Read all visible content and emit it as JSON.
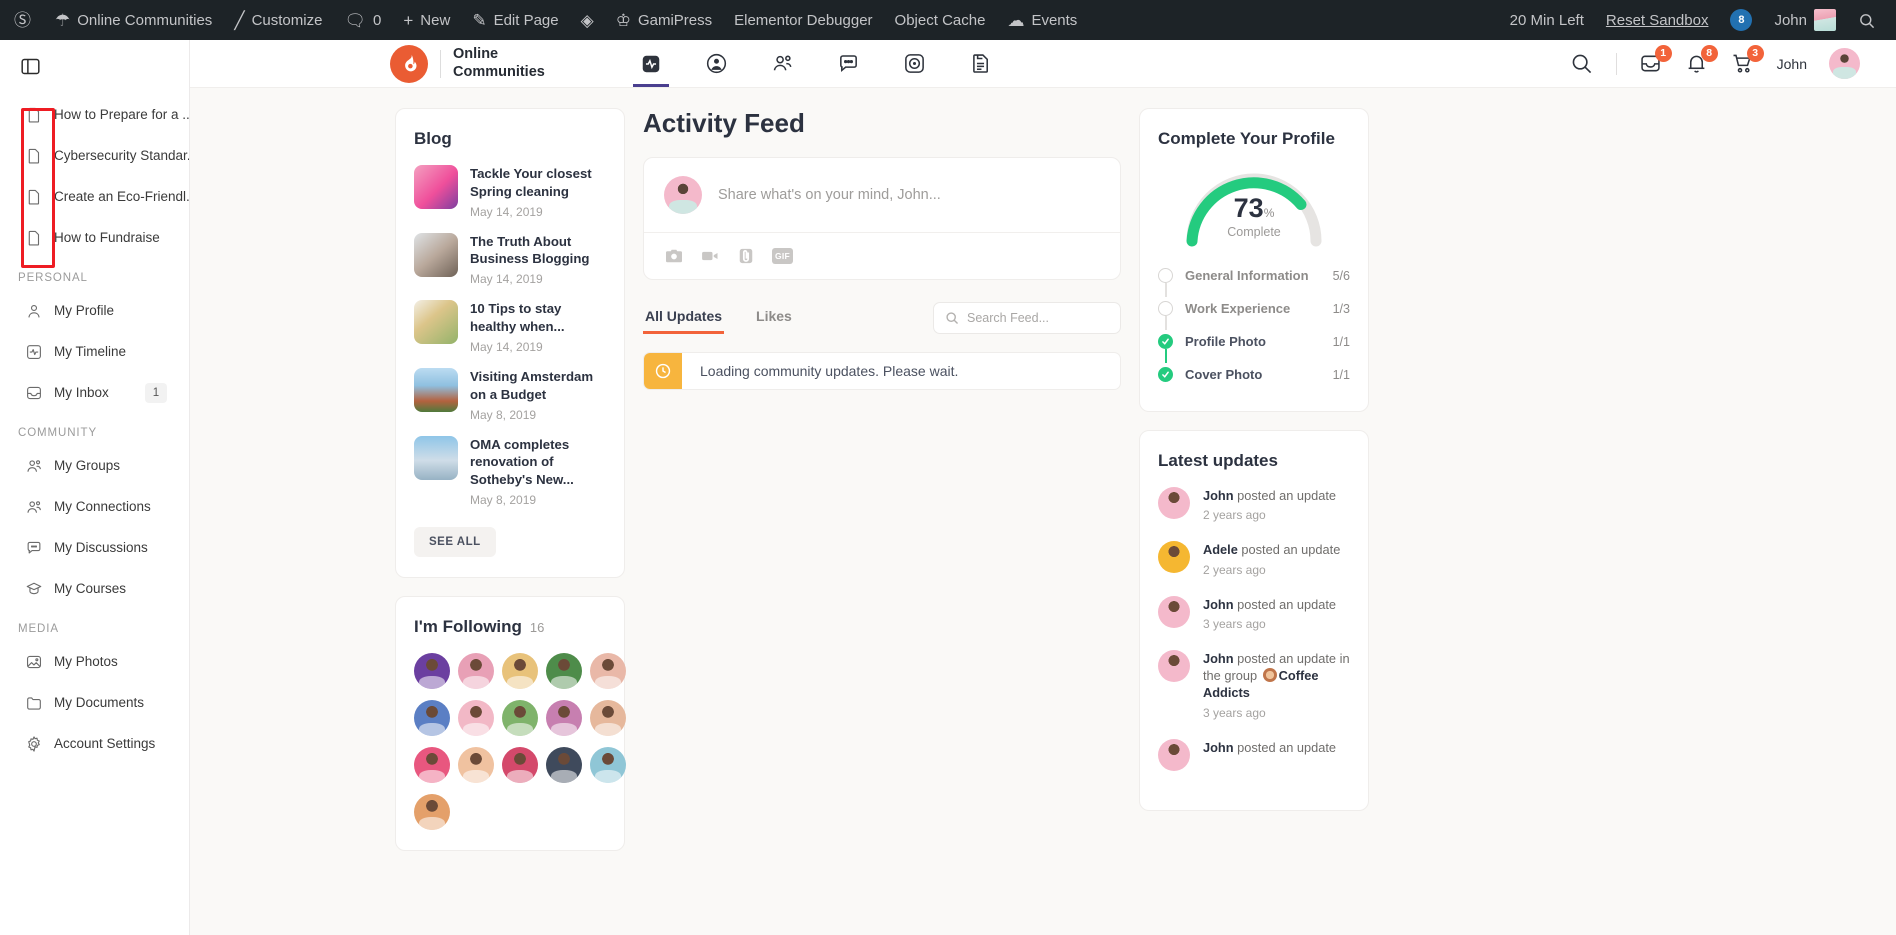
{
  "wp_admin_bar": {
    "left_items": [
      {
        "label": "",
        "icon": "wordpress-logo-icon"
      },
      {
        "label": "Online Communities",
        "icon": "dashboard-icon"
      },
      {
        "label": "Customize",
        "icon": "pencil-icon"
      },
      {
        "label": "0",
        "icon": "comment-icon"
      },
      {
        "label": "New",
        "icon": "plus-icon"
      },
      {
        "label": "Edit Page",
        "icon": "edit-icon"
      },
      {
        "label": "",
        "icon": "diamond-icon"
      },
      {
        "label": "GamiPress",
        "icon": "crown-icon"
      },
      {
        "label": "Elementor Debugger",
        "icon": ""
      },
      {
        "label": "Object Cache",
        "icon": ""
      },
      {
        "label": "Events",
        "icon": "events-icon"
      }
    ],
    "time_left": "20 Min Left",
    "reset_label": "Reset Sandbox",
    "notif_count": "8",
    "user_name": "John"
  },
  "sidebar": {
    "toggle_icon": "panel-toggle-icon",
    "pinned_items": [
      {
        "label": "How to Prepare for a ...",
        "icon": "document-icon"
      },
      {
        "label": "Cybersecurity Standar...",
        "icon": "document-icon"
      },
      {
        "label": "Create an Eco-Friendl...",
        "icon": "document-icon"
      },
      {
        "label": "How to Fundraise",
        "icon": "document-icon"
      }
    ],
    "sections": [
      {
        "heading": "PERSONAL",
        "items": [
          {
            "label": "My Profile",
            "icon": "user-icon",
            "badge": ""
          },
          {
            "label": "My Timeline",
            "icon": "activity-icon",
            "badge": ""
          },
          {
            "label": "My Inbox",
            "icon": "inbox-icon",
            "badge": "1"
          }
        ]
      },
      {
        "heading": "COMMUNITY",
        "items": [
          {
            "label": "My Groups",
            "icon": "group-icon",
            "badge": ""
          },
          {
            "label": "My Connections",
            "icon": "group-icon",
            "badge": ""
          },
          {
            "label": "My Discussions",
            "icon": "chat-icon",
            "badge": ""
          },
          {
            "label": "My Courses",
            "icon": "graduation-cap-icon",
            "badge": ""
          }
        ]
      },
      {
        "heading": "MEDIA",
        "items": [
          {
            "label": "My Photos",
            "icon": "photo-icon",
            "badge": ""
          },
          {
            "label": "My Documents",
            "icon": "folder-icon",
            "badge": ""
          },
          {
            "label": "Account Settings",
            "icon": "gear-icon",
            "badge": ""
          }
        ]
      }
    ]
  },
  "header": {
    "brand_line1": "Online",
    "brand_line2": "Communities",
    "logo_icon": "flame-logo-icon",
    "nav": [
      {
        "icon": "activity-icon",
        "active": true
      },
      {
        "icon": "profile-circle-icon",
        "active": false
      },
      {
        "icon": "members-icon",
        "active": false
      },
      {
        "icon": "chat-bubble-icon",
        "active": false
      },
      {
        "icon": "target-icon",
        "active": false
      },
      {
        "icon": "document-icon",
        "active": false
      }
    ],
    "search_icon": "search-icon",
    "inbox_badge": "1",
    "bell_badge": "8",
    "cart_badge": "3",
    "user_name": "John"
  },
  "blog": {
    "title": "Blog",
    "posts": [
      {
        "title": "Tackle Your closest Spring cleaning",
        "date": "May 14, 2019",
        "thumb": "bt1"
      },
      {
        "title": "The Truth About Business Blogging",
        "date": "May 14, 2019",
        "thumb": "bt2"
      },
      {
        "title": "10 Tips to stay healthy when...",
        "date": "May 14, 2019",
        "thumb": "bt3"
      },
      {
        "title": "Visiting Amsterdam on a Budget",
        "date": "May 8, 2019",
        "thumb": "bt4"
      },
      {
        "title": "OMA completes renovation of Sotheby's New...",
        "date": "May 8, 2019",
        "thumb": "bt5"
      }
    ],
    "see_all": "SEE ALL"
  },
  "following": {
    "title": "I'm Following",
    "count": "16",
    "avatars": [
      "#6b3fa0",
      "#e8a0b6",
      "#e8c27a",
      "#4e8c4a",
      "#e9b8a8",
      "#5b7fc4",
      "#f2b8c6",
      "#7fb36b",
      "#c77fb0",
      "#e6b89c",
      "#e8577f",
      "#f0c2a0",
      "#d4496b",
      "#3f4a5c",
      "#8fc6d6",
      "#e4a06a"
    ]
  },
  "feed": {
    "title": "Activity Feed",
    "composer_placeholder": "Share what's on your mind, John...",
    "tools": [
      "camera-icon",
      "video-icon",
      "attachment-icon",
      "gif-icon"
    ],
    "gif_label": "GIF",
    "tabs": [
      {
        "label": "All Updates",
        "active": true
      },
      {
        "label": "Likes",
        "active": false
      }
    ],
    "search_placeholder": "Search Feed...",
    "loading_text": "Loading community updates. Please wait.",
    "loading_icon": "clock-icon"
  },
  "profile_card": {
    "title": "Complete Your Profile",
    "percent": "73",
    "percent_symbol": "%",
    "complete_label": "Complete",
    "gauge_color": "#24cb7f",
    "gauge_track": "#e6e4e2",
    "steps": [
      {
        "label": "General Information",
        "value": "5/6",
        "done": false
      },
      {
        "label": "Work Experience",
        "value": "1/3",
        "done": false
      },
      {
        "label": "Profile Photo",
        "value": "1/1",
        "done": true
      },
      {
        "label": "Cover Photo",
        "value": "1/1",
        "done": true
      }
    ]
  },
  "latest_updates": {
    "title": "Latest updates",
    "items": [
      {
        "user": "John",
        "action": "posted an update",
        "group": "",
        "time": "2 years ago",
        "avatar": "#f4b9cb"
      },
      {
        "user": "Adele",
        "action": "posted an update",
        "group": "",
        "time": "2 years ago",
        "avatar": "#f5b731"
      },
      {
        "user": "John",
        "action": "posted an update",
        "group": "",
        "time": "3 years ago",
        "avatar": "#f4b9cb"
      },
      {
        "user": "John",
        "action": "posted an update in the group",
        "group": "Coffee Addicts",
        "time": "3 years ago",
        "avatar": "#f4b9cb"
      },
      {
        "user": "John",
        "action": "posted an update",
        "group": "",
        "time": "",
        "avatar": "#f4b9cb"
      }
    ]
  }
}
